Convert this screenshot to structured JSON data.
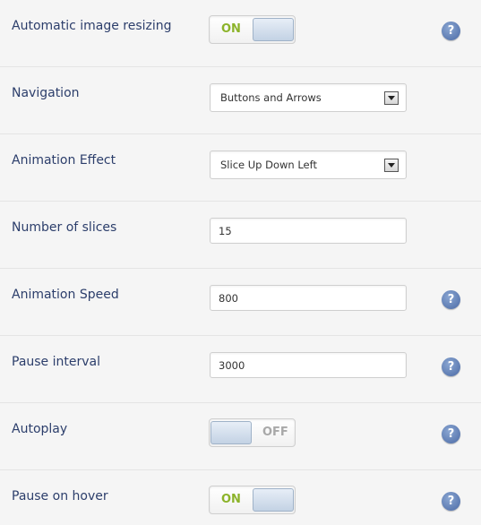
{
  "settings": {
    "rows": [
      {
        "label": "Automatic image resizing",
        "control": "toggle",
        "state": "ON",
        "help": "?"
      },
      {
        "label": "Navigation",
        "control": "select",
        "value": "Buttons and Arrows"
      },
      {
        "label": "Animation Effect",
        "control": "select",
        "value": "Slice Up Down Left"
      },
      {
        "label": "Number of slices",
        "control": "input",
        "value": "15"
      },
      {
        "label": "Animation Speed",
        "control": "input",
        "value": "800",
        "help": "?"
      },
      {
        "label": "Pause interval",
        "control": "input",
        "value": "3000",
        "help": "?"
      },
      {
        "label": "Autoplay",
        "control": "toggle",
        "state": "OFF",
        "help": "?"
      },
      {
        "label": "Pause on hover",
        "control": "toggle",
        "state": "ON",
        "help": "?"
      }
    ]
  },
  "icons": {
    "help": "help-icon",
    "dropdown": "chevron-down-icon"
  },
  "colors": {
    "label": "#2c3e6b",
    "toggle_on": "#8cb32a",
    "toggle_off": "#a8a8a8",
    "help_icon": "#4b6aa5",
    "background": "#f5f5f5"
  }
}
